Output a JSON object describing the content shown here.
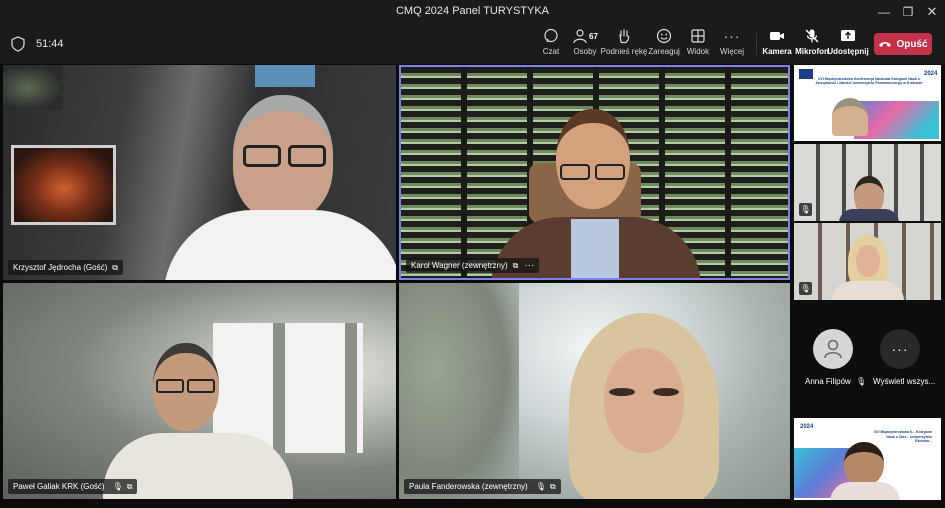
{
  "window": {
    "title": "CMQ 2024 Panel TURYSTYKA"
  },
  "meeting": {
    "timer": "51:44"
  },
  "toolbar": {
    "chat": "Czat",
    "people": "Osoby",
    "people_count": "67",
    "raise_hand": "Podnieś rękę",
    "react": "Zareaguj",
    "view": "Widok",
    "more": "Więcej",
    "camera": "Kamera",
    "mic": "Mikrofon",
    "share": "Udostępnij",
    "leave": "Opuść"
  },
  "participants": [
    {
      "name": "Krzysztof Jędrocha (Gość)"
    },
    {
      "name": "Karol Wagner (zewnętrzny)",
      "active_speaker": true
    },
    {
      "name": "Paweł Galiak KRK (Gość)"
    },
    {
      "name": "Paula Fanderowska (zewnętrzny)"
    }
  ],
  "sidebar": {
    "slide_year": "2024",
    "slide_title": "XVI Międzynarodowa Konferencja Naukowa Kolegium Nauk o Zarządzaniu i Jakości Uniwersytetu Ekonomicznego w Krakowie",
    "slide_title_short": "XVI Międzynarodowa K... Kolegium Nauk o Zarz... Uniwersytetu Ekonom...",
    "anna_name": "Anna Filipów",
    "show_all": "Wyświetl wszys..."
  },
  "colors": {
    "accent": "#7b83eb",
    "leave": "#c4314b",
    "toolbar": "#1b1b1b"
  }
}
